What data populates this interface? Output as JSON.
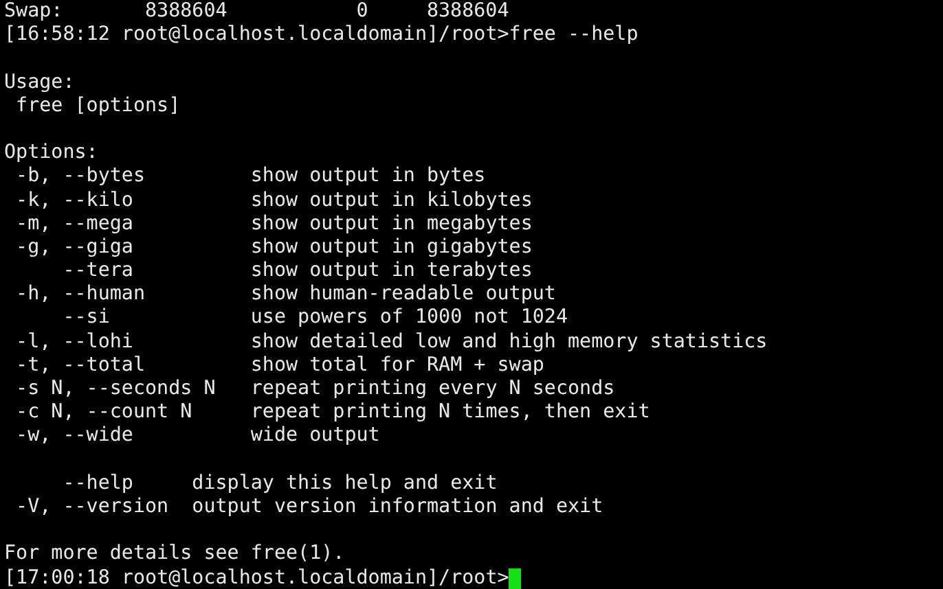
{
  "lines": [
    {
      "kind": "row",
      "cells": [
        "Swap:",
        "8388604",
        "0",
        "8388604"
      ]
    },
    {
      "kind": "text",
      "text": "[16:58:12 root@localhost.localdomain]/root>free --help"
    },
    {
      "kind": "blank"
    },
    {
      "kind": "text",
      "text": "Usage:"
    },
    {
      "kind": "text",
      "text": " free [options]"
    },
    {
      "kind": "blank"
    },
    {
      "kind": "text",
      "text": "Options:"
    },
    {
      "kind": "option",
      "flag": " -b, --bytes",
      "description": "show output in bytes"
    },
    {
      "kind": "option",
      "flag": " -k, --kilo",
      "description": "show output in kilobytes"
    },
    {
      "kind": "option",
      "flag": " -m, --mega",
      "description": "show output in megabytes"
    },
    {
      "kind": "option",
      "flag": " -g, --giga",
      "description": "show output in gigabytes"
    },
    {
      "kind": "option",
      "flag": "     --tera",
      "description": "show output in terabytes"
    },
    {
      "kind": "option",
      "flag": " -h, --human",
      "description": "show human-readable output"
    },
    {
      "kind": "option",
      "flag": "     --si",
      "description": "use powers of 1000 not 1024"
    },
    {
      "kind": "option",
      "flag": " -l, --lohi",
      "description": "show detailed low and high memory statistics"
    },
    {
      "kind": "option",
      "flag": " -t, --total",
      "description": "show total for RAM + swap"
    },
    {
      "kind": "option",
      "flag": " -s N, --seconds N",
      "description": "repeat printing every N seconds"
    },
    {
      "kind": "option",
      "flag": " -c N, --count N",
      "description": "repeat printing N times, then exit"
    },
    {
      "kind": "option",
      "flag": " -w, --wide",
      "description": "wide output"
    },
    {
      "kind": "blank"
    },
    {
      "kind": "short",
      "flag": "     --help",
      "description": "display this help and exit"
    },
    {
      "kind": "short",
      "flag": " -V, --version",
      "description": "output version information and exit"
    },
    {
      "kind": "blank"
    },
    {
      "kind": "text",
      "text": "For more details see free(1)."
    },
    {
      "kind": "prompt",
      "text": "[17:00:18 root@localhost.localdomain]/root>"
    }
  ]
}
